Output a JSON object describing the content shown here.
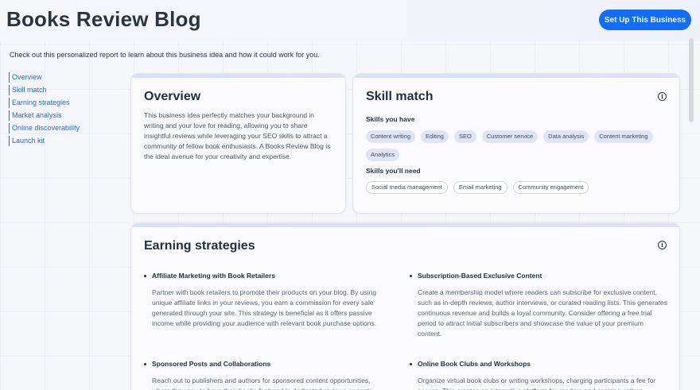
{
  "header": {
    "title": "Books Review Blog",
    "cta_label": "Set Up This Business"
  },
  "intro": "Check out this personalized report to learn about this business idea and how it could work for you.",
  "toc": [
    "Overview",
    "Skill match",
    "Earning strategies",
    "Market analysis",
    "Online discoverability",
    "Launch kit"
  ],
  "overview": {
    "title": "Overview",
    "text": "This business idea perfectly matches your background in writing and your love for reading, allowing you to share insightful reviews while leveraging your SEO skills to attract a community of fellow book enthusiasts. A Books Review Blog is the ideal avenue for your creativity and expertise."
  },
  "skill_match": {
    "title": "Skill match",
    "have_label": "Skills you have",
    "have": [
      "Content writing",
      "Editing",
      "SEO",
      "Customer service",
      "Data analysis",
      "Content marketing",
      "Analytics"
    ],
    "need_label": "Skills you'll need",
    "need": [
      "Social media management",
      "Email marketing",
      "Community engagement"
    ]
  },
  "earning": {
    "title": "Earning strategies",
    "items": [
      {
        "title": "Affiliate Marketing with Book Retailers",
        "desc": "Partner with book retailers to promote their products on your blog. By using unique affiliate links in your reviews, you earn a commission for every sale generated through your site. This strategy is beneficial as it offers passive income while providing your audience with relevant book purchase options."
      },
      {
        "title": "Subscription-Based Exclusive Content",
        "desc": "Create a membership model where readers can subscribe for exclusive content, such as in-depth reviews, author interviews, or curated reading lists. This generates continuous revenue and builds a loyal community. Consider offering a free trial period to attract initial subscribers and showcase the value of your premium content."
      },
      {
        "title": "Sponsored Posts and Collaborations",
        "desc": "Reach out to publishers and authors for sponsored content opportunities, where they pay to have their books featured in dedicated reviews or posts."
      },
      {
        "title": "Online Book Clubs and Workshops",
        "desc": "Organize virtual book clubs or writing workshops, charging participants a fee for access. This creates an interactive platform for readers and aspiring writers."
      }
    ]
  },
  "colors": {
    "accent": "#116dff",
    "chip_have_bg": "#dfe5f5"
  },
  "icons": {
    "info": "info-icon"
  }
}
